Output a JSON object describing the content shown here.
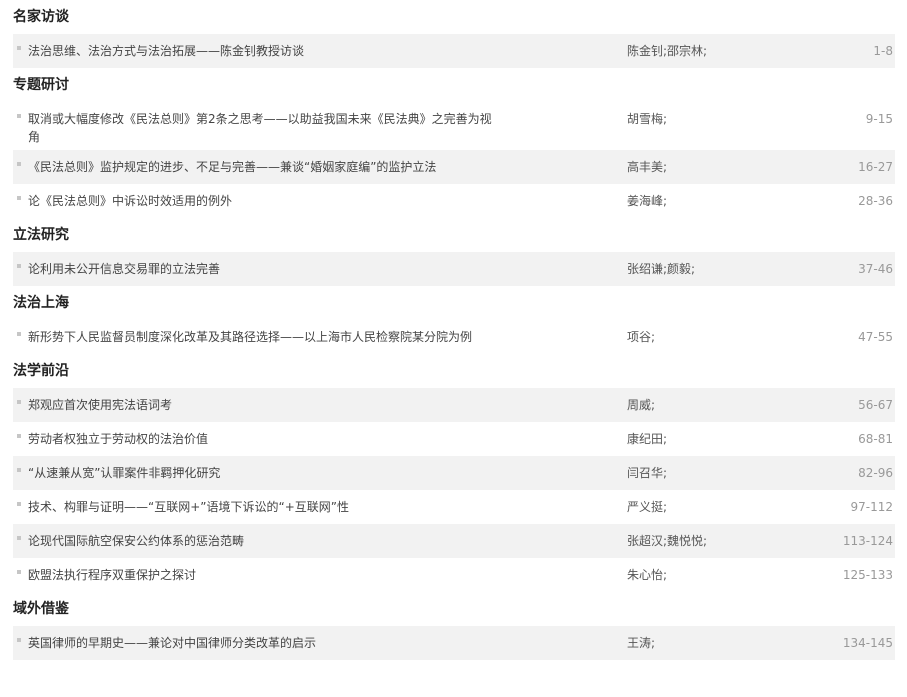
{
  "sections": [
    {
      "title": "名家访谈",
      "articles": [
        {
          "title": "法治思维、法治方式与法治拓展——陈金钊教授访谈",
          "authors": "陈金钊;邵宗林;",
          "pages": "1-8"
        }
      ]
    },
    {
      "title": "专题研讨",
      "articles": [
        {
          "title": "取消或大幅度修改《民法总则》第2条之思考——以助益我国未来《民法典》之完善为视角",
          "authors": "胡雪梅;",
          "pages": "9-15"
        },
        {
          "title": "《民法总则》监护规定的进步、不足与完善——兼谈“婚姻家庭编”的监护立法",
          "authors": "高丰美;",
          "pages": "16-27"
        },
        {
          "title": "论《民法总则》中诉讼时效适用的例外",
          "authors": "姜海峰;",
          "pages": "28-36"
        }
      ]
    },
    {
      "title": "立法研究",
      "articles": [
        {
          "title": "论利用未公开信息交易罪的立法完善",
          "authors": "张绍谦;颜毅;",
          "pages": "37-46"
        }
      ]
    },
    {
      "title": "法治上海",
      "articles": [
        {
          "title": "新形势下人民监督员制度深化改革及其路径选择——以上海市人民检察院某分院为例",
          "authors": "项谷;",
          "pages": "47-55"
        }
      ]
    },
    {
      "title": "法学前沿",
      "articles": [
        {
          "title": "郑观应首次使用宪法语词考",
          "authors": "周威;",
          "pages": "56-67"
        },
        {
          "title": "劳动者权独立于劳动权的法治价值",
          "authors": "康纪田;",
          "pages": "68-81"
        },
        {
          "title": "“从速兼从宽”认罪案件非羁押化研究",
          "authors": "闫召华;",
          "pages": "82-96"
        },
        {
          "title": "技术、构罪与证明——“互联网+”语境下诉讼的“+互联网”性",
          "authors": "严义挺;",
          "pages": "97-112"
        },
        {
          "title": "论现代国际航空保安公约体系的惩治范畴",
          "authors": "张超汉;魏悦悦;",
          "pages": "113-124"
        },
        {
          "title": "欧盟法执行程序双重保护之探讨",
          "authors": "朱心怡;",
          "pages": "125-133"
        }
      ]
    },
    {
      "title": "域外借鉴",
      "articles": [
        {
          "title": "英国律师的早期史——兼论对中国律师分类改革的启示",
          "authors": "王涛;",
          "pages": "134-145"
        }
      ]
    }
  ]
}
